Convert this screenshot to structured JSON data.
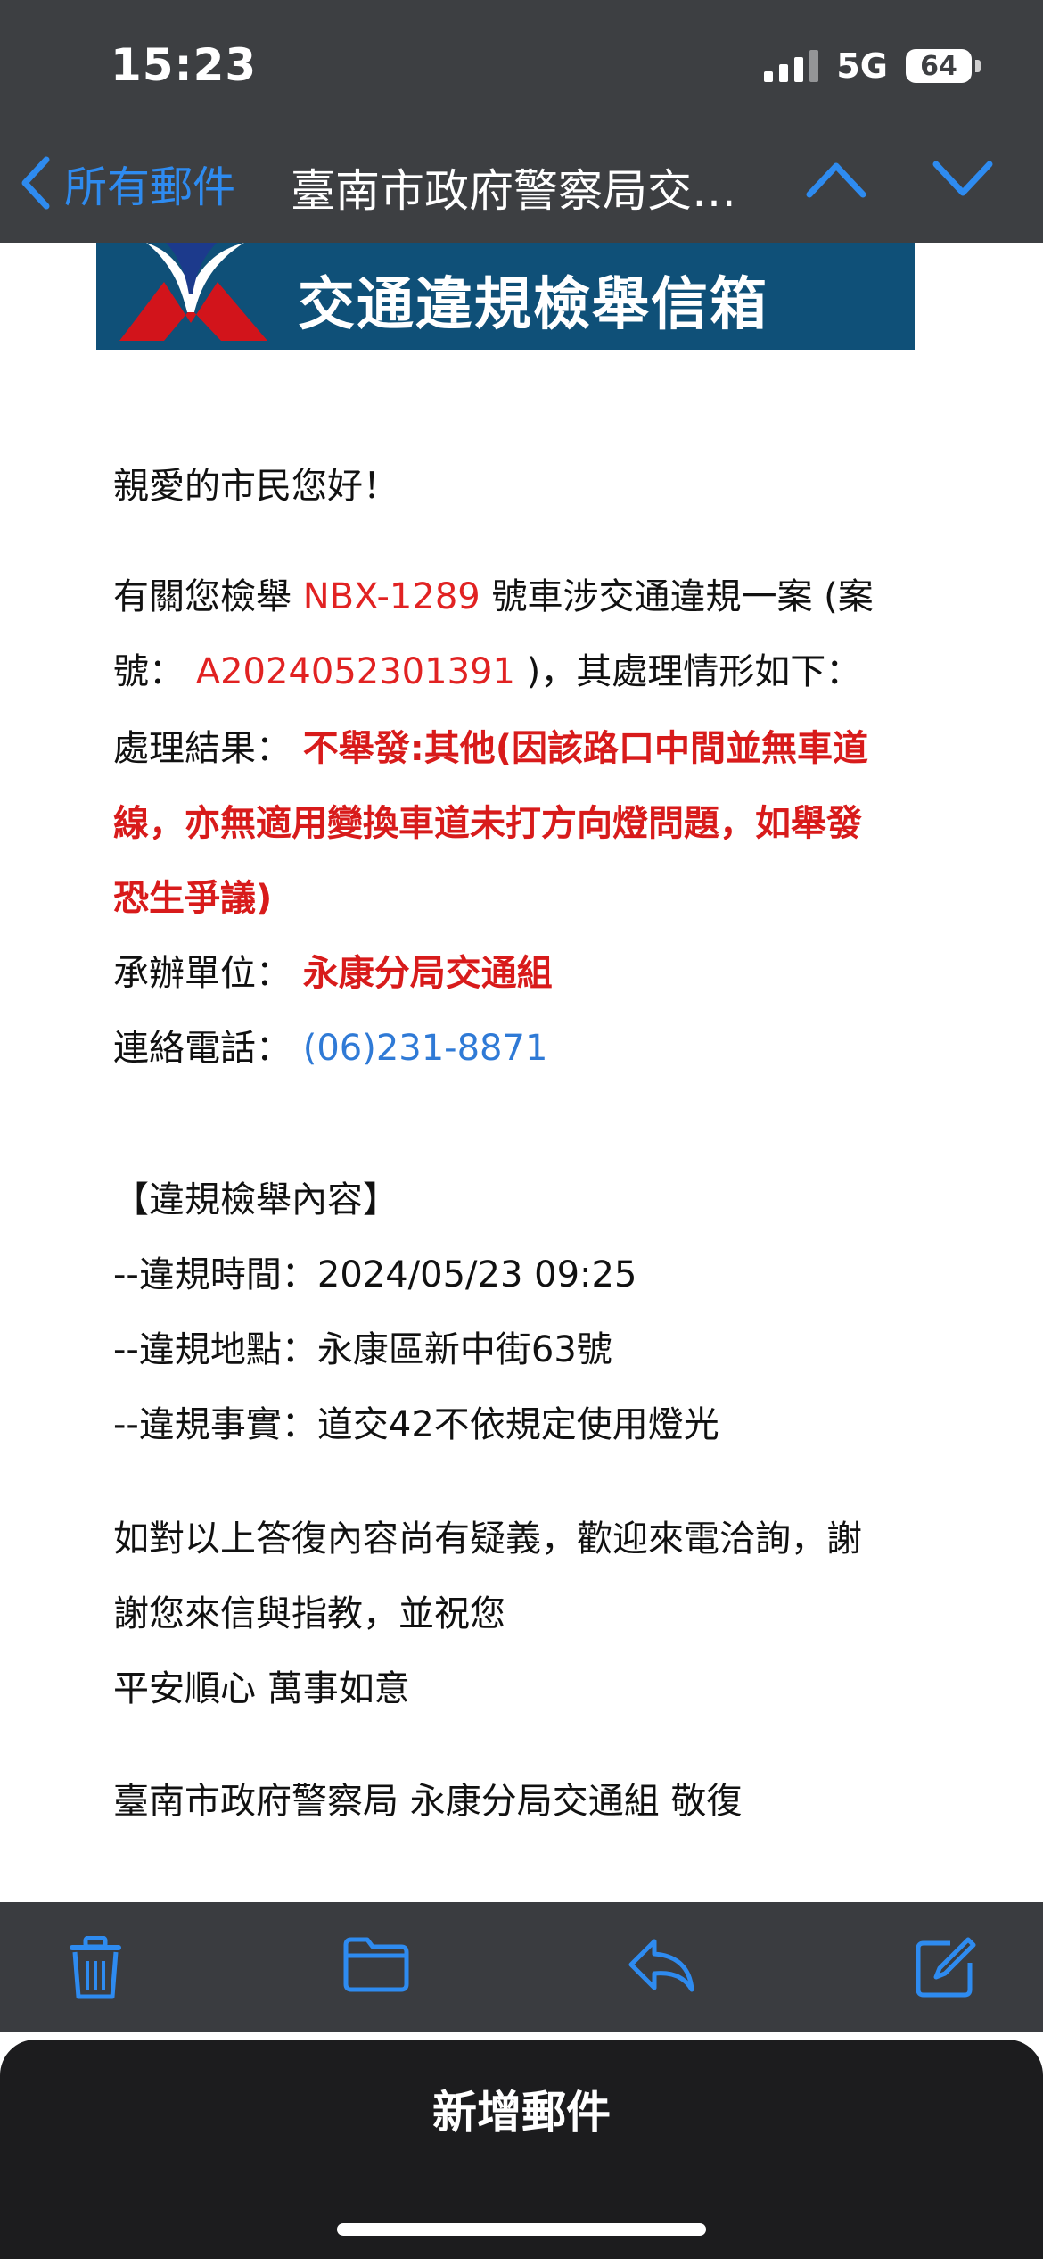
{
  "status": {
    "time": "15:23",
    "network": "5G",
    "battery": "64"
  },
  "nav": {
    "back_label": "所有郵件",
    "title": "臺南市政府警察局交通違規檢舉信箱",
    "up_icon": "chevron-up-icon",
    "down_icon": "chevron-down-icon"
  },
  "banner": {
    "title": "交通違規檢舉信箱"
  },
  "email": {
    "greeting": "親愛的市民您好！",
    "intro_a": "有關您檢舉",
    "plate": "NBX-1289",
    "intro_b": "號車涉交通違規一案 (案",
    "case_label": "號：",
    "case_no": "A2024052301391",
    "case_tail": ")，其處理情形如下：",
    "result_label": "處理結果：",
    "result_line1": "不舉發:其他(因該路口中間並無車道",
    "result_line2": "線，亦無適用變換車道未打方向燈問題，如舉發",
    "result_line3": "恐生爭議)",
    "unit_label": "承辦單位：",
    "unit_value": "永康分局交通組",
    "phone_label": "連絡電話：",
    "phone_value": "(06)231-8871",
    "section_title": "【違規檢舉內容】",
    "time_line": "--違規時間：2024/05/23 09:25",
    "place_line": "--違規地點：永康區新中街63號",
    "fact_line": "--違規事實：道交42不依規定使用燈光",
    "closing1": "如對以上答復內容尚有疑義，歡迎來電洽詢，謝",
    "closing2": "謝您來信與指教，並祝您",
    "closing3": "平安順心 萬事如意",
    "signature": "臺南市政府警察局 永康分局交通組 敬復"
  },
  "toolbar": {
    "icons": [
      "trash-icon",
      "folder-icon",
      "reply-icon",
      "compose-icon"
    ],
    "accent": "#2e8bf0"
  },
  "sheet": {
    "title": "新增郵件"
  }
}
